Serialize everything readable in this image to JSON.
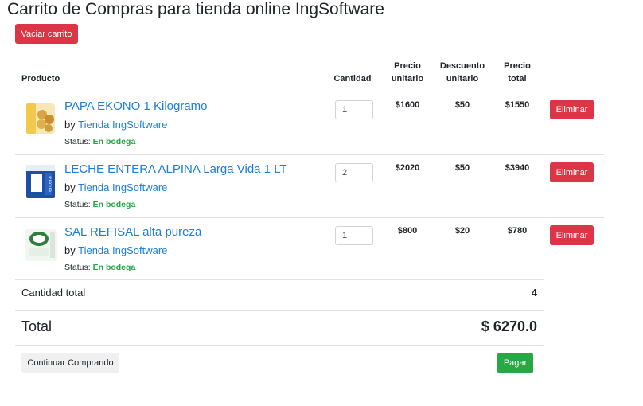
{
  "page": {
    "title": "Carrito de Compras para tienda online IngSoftware"
  },
  "toolbar": {
    "empty_cart_label": "Vaciar carrito"
  },
  "table": {
    "headers": {
      "product": "Producto",
      "quantity": "Cantidad",
      "unit_price_1": "Precio",
      "unit_price_2": "unitario",
      "unit_discount_1": "Descuento",
      "unit_discount_2": "unitario",
      "total_price_1": "Precio",
      "total_price_2": "total"
    },
    "items": [
      {
        "name": "PAPA EKONO 1 Kilogramo",
        "by": "by",
        "seller": "Tienda IngSoftware",
        "status_label": "Status:",
        "status": "En bodega",
        "quantity": "1",
        "unit_price": "$1600",
        "discount": "$50",
        "total": "$1550",
        "remove_label": "Eliminar",
        "thumb_icon": "potato-bag-image"
      },
      {
        "name": "LECHE ENTERA ALPINA Larga Vida 1 LT",
        "by": "by",
        "seller": "Tienda IngSoftware",
        "status_label": "Status:",
        "status": "En bodega",
        "quantity": "2",
        "unit_price": "$2020",
        "discount": "$50",
        "total": "$3940",
        "remove_label": "Eliminar",
        "thumb_icon": "milk-carton-image"
      },
      {
        "name": "SAL REFISAL alta pureza",
        "by": "by",
        "seller": "Tienda IngSoftware",
        "status_label": "Status:",
        "status": "En bodega",
        "quantity": "1",
        "unit_price": "$800",
        "discount": "$20",
        "total": "$780",
        "remove_label": "Eliminar",
        "thumb_icon": "salt-bag-image"
      }
    ]
  },
  "summary": {
    "quantity_label": "Cantidad total",
    "quantity_value": "4",
    "total_label": "Total",
    "total_value": "$ 6270.0"
  },
  "actions": {
    "continue_label": "Continuar Comprando",
    "pay_label": "Pagar"
  },
  "colors": {
    "danger": "#dc3545",
    "success": "#28a745",
    "link": "#1e7fd6"
  }
}
